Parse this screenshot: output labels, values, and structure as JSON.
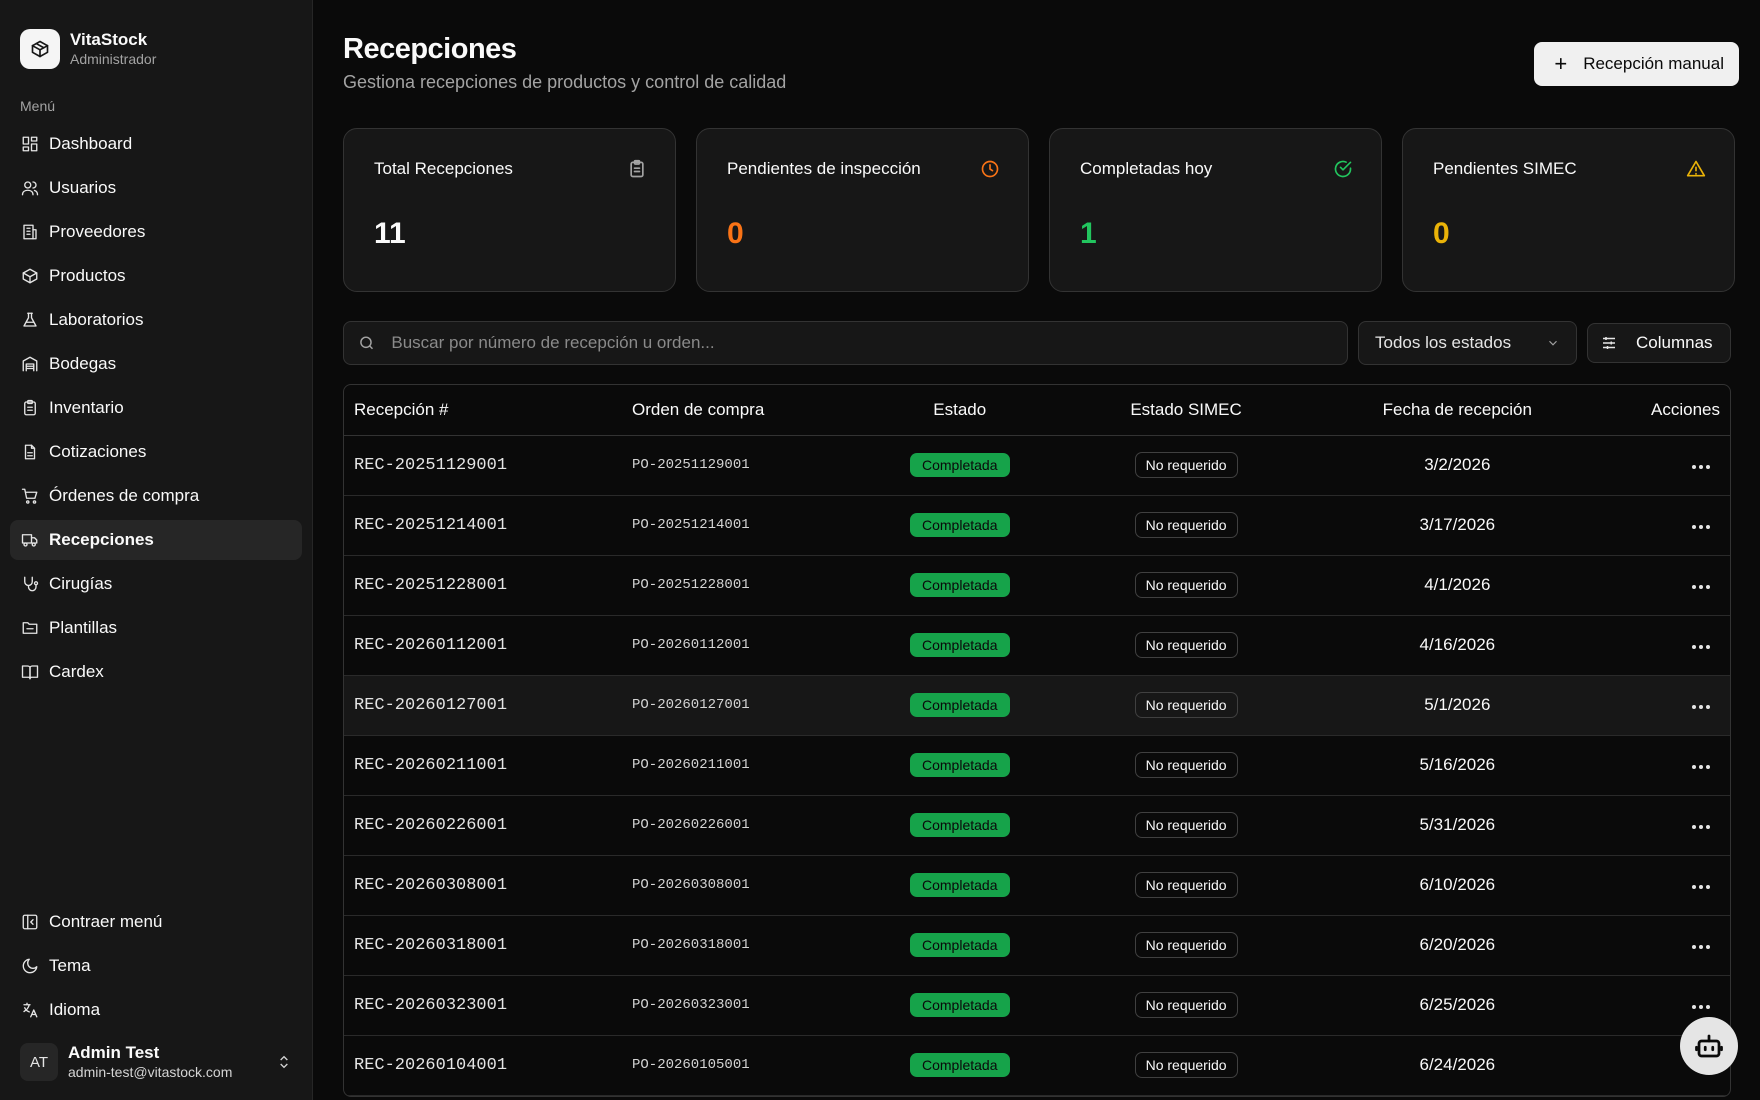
{
  "brand": {
    "name": "VitaStock",
    "role": "Administrador"
  },
  "sidebar": {
    "menu_label": "Menú",
    "items": [
      {
        "label": "Dashboard",
        "icon": "dashboard-icon"
      },
      {
        "label": "Usuarios",
        "icon": "users-icon"
      },
      {
        "label": "Proveedores",
        "icon": "building-icon"
      },
      {
        "label": "Productos",
        "icon": "package-icon"
      },
      {
        "label": "Laboratorios",
        "icon": "flask-icon"
      },
      {
        "label": "Bodegas",
        "icon": "warehouse-icon"
      },
      {
        "label": "Inventario",
        "icon": "clipboard-icon"
      },
      {
        "label": "Cotizaciones",
        "icon": "file-icon"
      },
      {
        "label": "Órdenes de compra",
        "icon": "cart-icon"
      },
      {
        "label": "Recepciones",
        "icon": "truck-icon",
        "active": true
      },
      {
        "label": "Cirugías",
        "icon": "stethoscope-icon"
      },
      {
        "label": "Plantillas",
        "icon": "folder-icon"
      },
      {
        "label": "Cardex",
        "icon": "book-icon"
      }
    ],
    "bottom": {
      "collapse": "Contraer menú",
      "theme": "Tema",
      "language": "Idioma"
    },
    "user": {
      "initials": "AT",
      "name": "Admin Test",
      "email": "admin-test@vitastock.com"
    }
  },
  "page": {
    "title": "Recepciones",
    "subtitle": "Gestiona recepciones de productos y control de calidad",
    "manual_button": "Recepción manual"
  },
  "cards": [
    {
      "title": "Total Recepciones",
      "value": "11",
      "color": "#fafafa",
      "icon": "clipboard-icon",
      "icon_color": "#a3a3a3"
    },
    {
      "title": "Pendientes de inspección",
      "value": "0",
      "color": "#f97316",
      "icon": "clock-icon",
      "icon_color": "#f97316"
    },
    {
      "title": "Completadas hoy",
      "value": "1",
      "color": "#22c55e",
      "icon": "check-circle-icon",
      "icon_color": "#22c55e"
    },
    {
      "title": "Pendientes SIMEC",
      "value": "0",
      "color": "#eab308",
      "icon": "warning-icon",
      "icon_color": "#eab308"
    }
  ],
  "filters": {
    "search_placeholder": "Buscar por número de recepción u orden...",
    "status_select": "Todos los estados",
    "columns_button": "Columnas"
  },
  "table": {
    "headers": [
      "Recepción #",
      "Orden de compra",
      "Estado",
      "Estado SIMEC",
      "Fecha de recepción",
      "Acciones"
    ],
    "rows": [
      {
        "rec": "REC-20251129001",
        "po": "PO-20251129001",
        "status": "Completada",
        "simec": "No requerido",
        "date": "3/2/2026"
      },
      {
        "rec": "REC-20251214001",
        "po": "PO-20251214001",
        "status": "Completada",
        "simec": "No requerido",
        "date": "3/17/2026"
      },
      {
        "rec": "REC-20251228001",
        "po": "PO-20251228001",
        "status": "Completada",
        "simec": "No requerido",
        "date": "4/1/2026"
      },
      {
        "rec": "REC-20260112001",
        "po": "PO-20260112001",
        "status": "Completada",
        "simec": "No requerido",
        "date": "4/16/2026"
      },
      {
        "rec": "REC-20260127001",
        "po": "PO-20260127001",
        "status": "Completada",
        "simec": "No requerido",
        "date": "5/1/2026",
        "highlight": true
      },
      {
        "rec": "REC-20260211001",
        "po": "PO-20260211001",
        "status": "Completada",
        "simec": "No requerido",
        "date": "5/16/2026"
      },
      {
        "rec": "REC-20260226001",
        "po": "PO-20260226001",
        "status": "Completada",
        "simec": "No requerido",
        "date": "5/31/2026"
      },
      {
        "rec": "REC-20260308001",
        "po": "PO-20260308001",
        "status": "Completada",
        "simec": "No requerido",
        "date": "6/10/2026"
      },
      {
        "rec": "REC-20260318001",
        "po": "PO-20260318001",
        "status": "Completada",
        "simec": "No requerido",
        "date": "6/20/2026"
      },
      {
        "rec": "REC-20260323001",
        "po": "PO-20260323001",
        "status": "Completada",
        "simec": "No requerido",
        "date": "6/25/2026"
      },
      {
        "rec": "REC-20260104001",
        "po": "PO-20260105001",
        "status": "Completada",
        "simec": "No requerido",
        "date": "6/24/2026"
      }
    ]
  }
}
